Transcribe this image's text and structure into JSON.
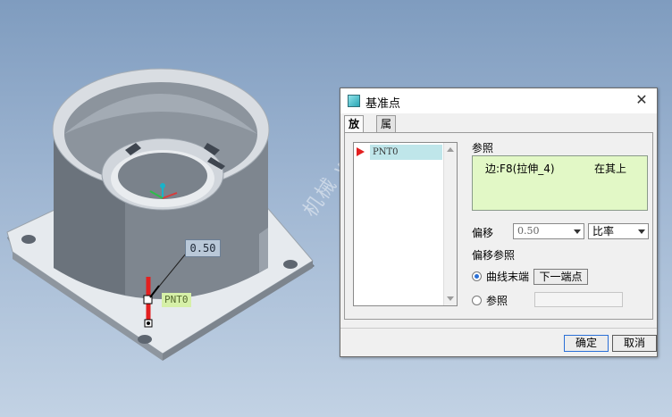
{
  "viewport": {
    "dimension_value": "0.50",
    "point_label": "PNT0",
    "watermark": "机械 www."
  },
  "dialog": {
    "title": "基准点",
    "close_glyph": "✕",
    "tabs": [
      {
        "label": "放置",
        "active": true
      },
      {
        "label": "属性",
        "active": false
      }
    ],
    "points_list": [
      "PNT0"
    ],
    "reference_label": "参照",
    "reference": {
      "edge": "边:F8(拉伸_4)",
      "constraint": "在其上"
    },
    "offset_label": "偏移",
    "offset_value": "0.50",
    "offset_type": "比率",
    "offset_ref_label": "偏移参照",
    "options": [
      {
        "label": "曲线末端",
        "selected": true
      },
      {
        "label": "参照",
        "selected": false
      }
    ],
    "next_end_button": "下一端点",
    "ok_button": "确定",
    "cancel_button": "取消"
  },
  "colors": {
    "accent": "#2a6fd6",
    "reference_bg": "#e2f8c6",
    "point_marker": "#e32020"
  }
}
